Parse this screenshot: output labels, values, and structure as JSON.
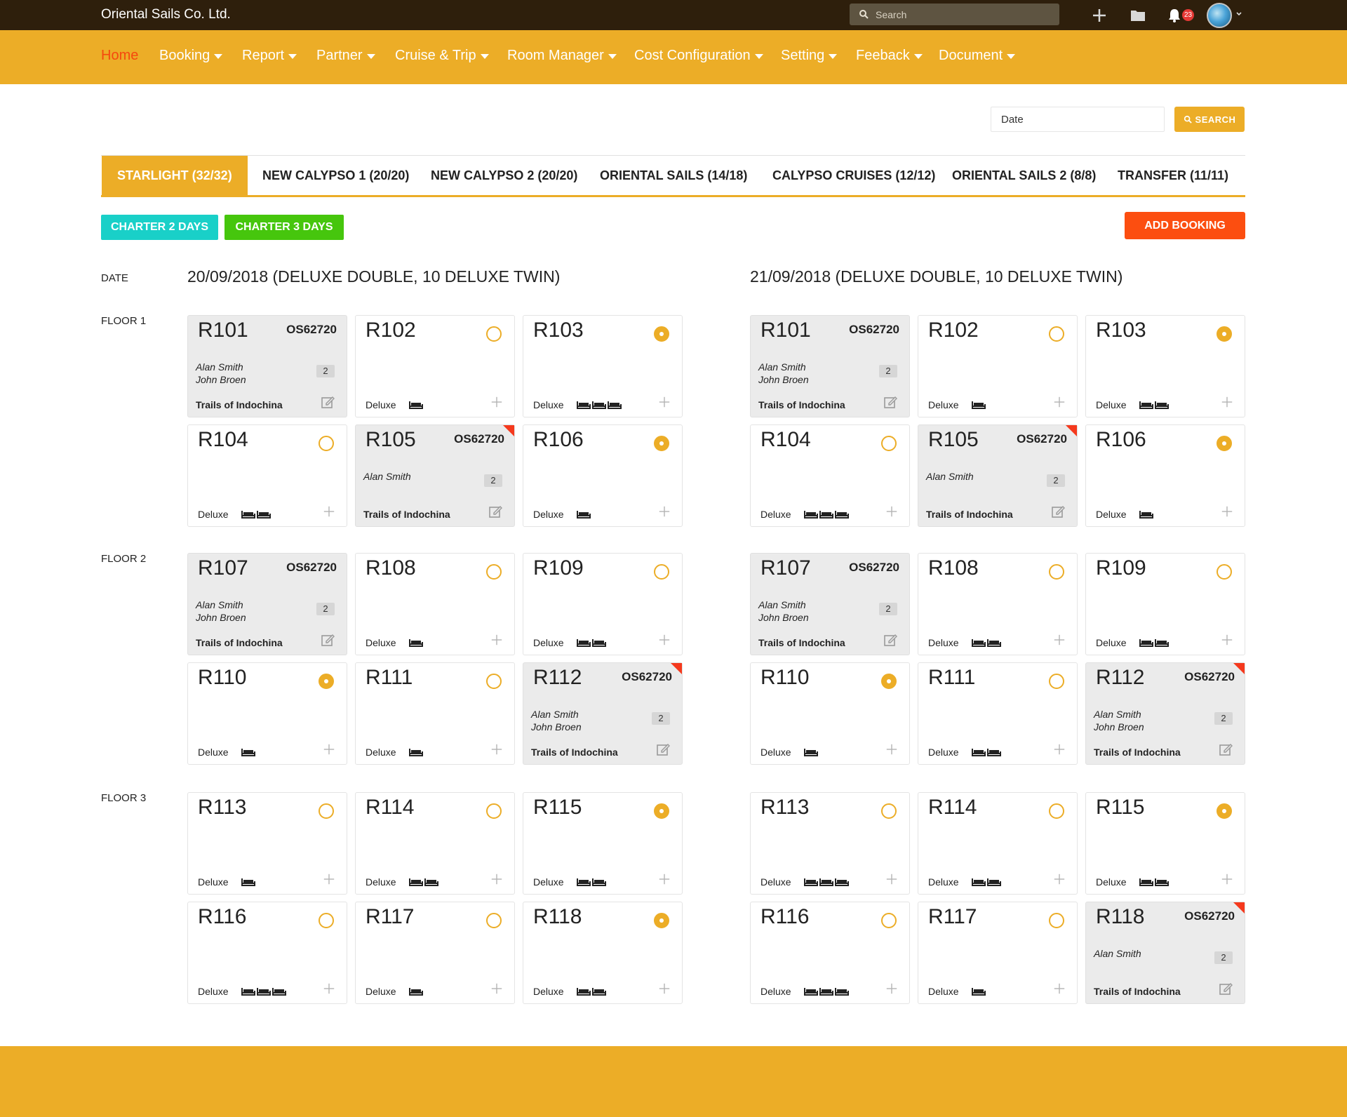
{
  "app": {
    "title": "Oriental Sails Co. Ltd."
  },
  "search": {
    "placeholder": "Search"
  },
  "notifications": {
    "count": "23"
  },
  "nav": [
    {
      "label": "Home",
      "active": true,
      "dropdown": false
    },
    {
      "label": "Booking",
      "dropdown": true
    },
    {
      "label": "Report",
      "dropdown": true
    },
    {
      "label": "Partner",
      "dropdown": true
    },
    {
      "label": "Cruise & Trip",
      "dropdown": true
    },
    {
      "label": "Room Manager",
      "dropdown": true
    },
    {
      "label": "Cost Configuration",
      "dropdown": true
    },
    {
      "label": "Setting",
      "dropdown": true
    },
    {
      "label": "Feeback",
      "dropdown": true
    },
    {
      "label": "Document",
      "dropdown": true
    }
  ],
  "filter": {
    "date_placeholder": "Date",
    "search_label": "SEARCH"
  },
  "tabs": [
    {
      "label": "STARLIGHT (32/32)",
      "active": true
    },
    {
      "label": "NEW CALYPSO 1 (20/20)"
    },
    {
      "label": "NEW CALYPSO 2 (20/20)"
    },
    {
      "label": "ORIENTAL SAILS (14/18)"
    },
    {
      "label": "CALYPSO CRUISES (12/12)"
    },
    {
      "label": "ORIENTAL SAILS 2 (8/8)"
    },
    {
      "label": "TRANSFER (11/11)"
    }
  ],
  "actions": {
    "charter2": "CHARTER 2 DAYS",
    "charter3": "CHARTER 3 DAYS",
    "add_booking": "ADD BOOKING"
  },
  "labels": {
    "date": "DATE",
    "floors": [
      "FLOOR 1",
      "FLOOR 2",
      "FLOOR 3"
    ]
  },
  "days": [
    {
      "header": "20/09/2018 (DELUXE DOUBLE, 10 DELUXE TWIN)",
      "rooms": [
        {
          "name": "R101",
          "booked": true,
          "code": "OS62720",
          "guests": [
            "Alan Smith",
            "John Broen"
          ],
          "pax": "2",
          "trip": "Trails of Indochina",
          "flag": false
        },
        {
          "name": "R102",
          "booked": false,
          "selected": false,
          "type": "Deluxe",
          "beds": "double"
        },
        {
          "name": "R103",
          "booked": false,
          "selected": true,
          "type": "Deluxe",
          "beds": "triple"
        },
        {
          "name": "R104",
          "booked": false,
          "selected": false,
          "type": "Deluxe",
          "beds": "twin"
        },
        {
          "name": "R105",
          "booked": true,
          "code": "OS62720",
          "guests": [
            "Alan Smith"
          ],
          "pax": "2",
          "trip": "Trails of Indochina",
          "flag": true
        },
        {
          "name": "R106",
          "booked": false,
          "selected": true,
          "type": "Deluxe",
          "beds": "double"
        },
        {
          "name": "R107",
          "booked": true,
          "code": "OS62720",
          "guests": [
            "Alan Smith",
            "John Broen"
          ],
          "pax": "2",
          "trip": "Trails of Indochina",
          "flag": false
        },
        {
          "name": "R108",
          "booked": false,
          "selected": false,
          "type": "Deluxe",
          "beds": "double"
        },
        {
          "name": "R109",
          "booked": false,
          "selected": false,
          "type": "Deluxe",
          "beds": "twin"
        },
        {
          "name": "R110",
          "booked": false,
          "selected": true,
          "type": "Deluxe",
          "beds": "double"
        },
        {
          "name": "R111",
          "booked": false,
          "selected": false,
          "type": "Deluxe",
          "beds": "double"
        },
        {
          "name": "R112",
          "booked": true,
          "code": "OS62720",
          "guests": [
            "Alan Smith",
            "John Broen"
          ],
          "pax": "2",
          "trip": "Trails of Indochina",
          "flag": true
        },
        {
          "name": "R113",
          "booked": false,
          "selected": false,
          "type": "Deluxe",
          "beds": "double"
        },
        {
          "name": "R114",
          "booked": false,
          "selected": false,
          "type": "Deluxe",
          "beds": "twin"
        },
        {
          "name": "R115",
          "booked": false,
          "selected": true,
          "type": "Deluxe",
          "beds": "twin"
        },
        {
          "name": "R116",
          "booked": false,
          "selected": false,
          "type": "Deluxe",
          "beds": "triple"
        },
        {
          "name": "R117",
          "booked": false,
          "selected": false,
          "type": "Deluxe",
          "beds": "double"
        },
        {
          "name": "R118",
          "booked": false,
          "selected": true,
          "type": "Deluxe",
          "beds": "twin"
        }
      ]
    },
    {
      "header": "21/09/2018 (DELUXE DOUBLE, 10 DELUXE TWIN)",
      "rooms": [
        {
          "name": "R101",
          "booked": true,
          "code": "OS62720",
          "guests": [
            "Alan Smith",
            "John Broen"
          ],
          "pax": "2",
          "trip": "Trails of Indochina",
          "flag": false
        },
        {
          "name": "R102",
          "booked": false,
          "selected": false,
          "type": "Deluxe",
          "beds": "double"
        },
        {
          "name": "R103",
          "booked": false,
          "selected": true,
          "type": "Deluxe",
          "beds": "twin"
        },
        {
          "name": "R104",
          "booked": false,
          "selected": false,
          "type": "Deluxe",
          "beds": "triple"
        },
        {
          "name": "R105",
          "booked": true,
          "code": "OS62720",
          "guests": [
            "Alan Smith"
          ],
          "pax": "2",
          "trip": "Trails of Indochina",
          "flag": true
        },
        {
          "name": "R106",
          "booked": false,
          "selected": true,
          "type": "Deluxe",
          "beds": "double"
        },
        {
          "name": "R107",
          "booked": true,
          "code": "OS62720",
          "guests": [
            "Alan Smith",
            "John Broen"
          ],
          "pax": "2",
          "trip": "Trails of Indochina",
          "flag": false
        },
        {
          "name": "R108",
          "booked": false,
          "selected": false,
          "type": "Deluxe",
          "beds": "twin"
        },
        {
          "name": "R109",
          "booked": false,
          "selected": false,
          "type": "Deluxe",
          "beds": "twin"
        },
        {
          "name": "R110",
          "booked": false,
          "selected": true,
          "type": "Deluxe",
          "beds": "double"
        },
        {
          "name": "R111",
          "booked": false,
          "selected": false,
          "type": "Deluxe",
          "beds": "twin"
        },
        {
          "name": "R112",
          "booked": true,
          "code": "OS62720",
          "guests": [
            "Alan Smith",
            "John Broen"
          ],
          "pax": "2",
          "trip": "Trails of Indochina",
          "flag": true
        },
        {
          "name": "R113",
          "booked": false,
          "selected": false,
          "type": "Deluxe",
          "beds": "triple"
        },
        {
          "name": "R114",
          "booked": false,
          "selected": false,
          "type": "Deluxe",
          "beds": "twin"
        },
        {
          "name": "R115",
          "booked": false,
          "selected": true,
          "type": "Deluxe",
          "beds": "twin"
        },
        {
          "name": "R116",
          "booked": false,
          "selected": false,
          "type": "Deluxe",
          "beds": "triple"
        },
        {
          "name": "R117",
          "booked": false,
          "selected": false,
          "type": "Deluxe",
          "beds": "double"
        },
        {
          "name": "R118",
          "booked": true,
          "code": "OS62720",
          "guests": [
            "Alan Smith"
          ],
          "pax": "2",
          "trip": "Trails of Indochina",
          "flag": true
        }
      ]
    }
  ],
  "colors": {
    "accent": "#ecad27",
    "topbar": "#2e1f0c",
    "active_nav": "#f5480e",
    "add_booking": "#fc4e10",
    "charter2": "#19d0c8",
    "charter3": "#46c60d",
    "flag": "#f5391d"
  }
}
